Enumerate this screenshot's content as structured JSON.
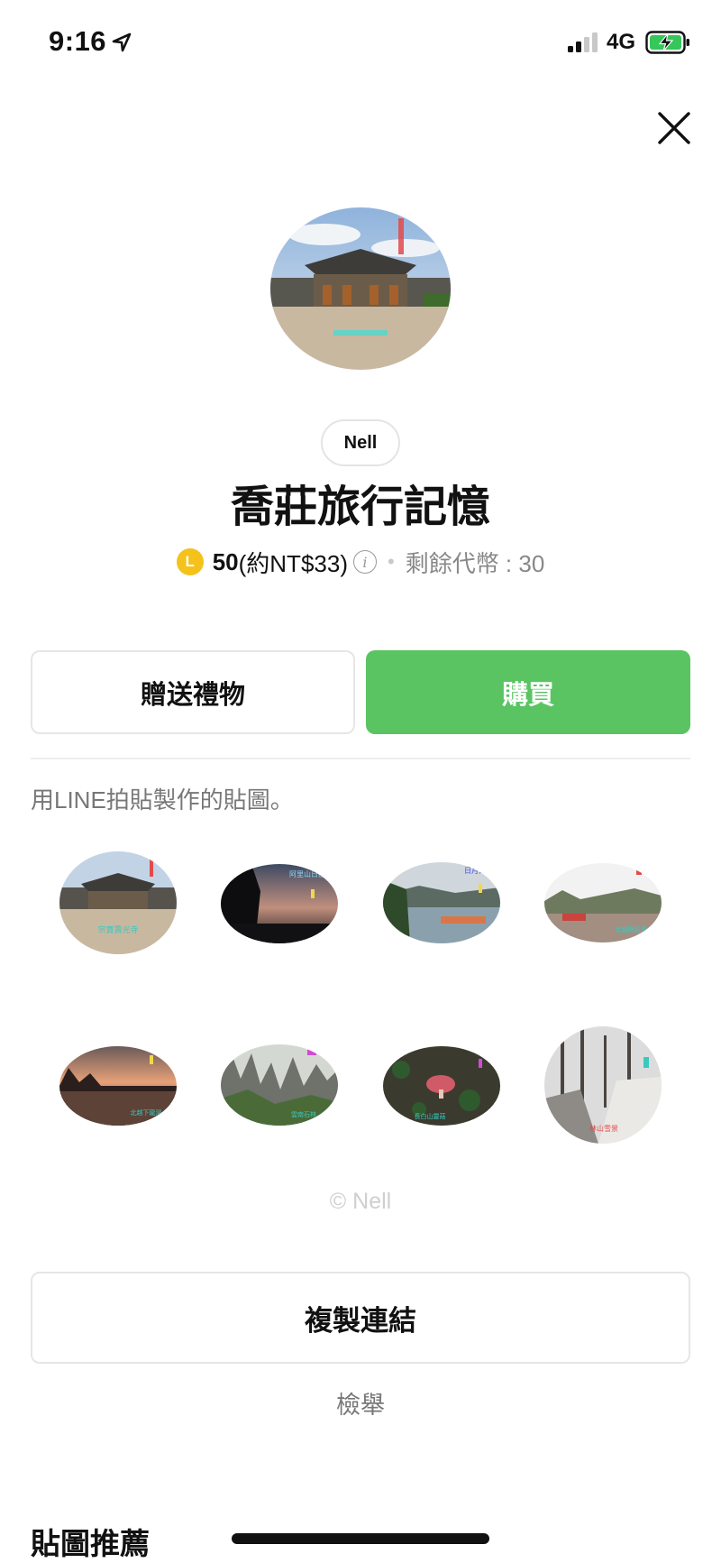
{
  "status_bar": {
    "time": "9:16",
    "network": "4G",
    "location_icon": "location-arrow-icon",
    "signal_icon": "signal-icon",
    "battery_icon": "battery-charging-icon"
  },
  "header": {
    "close_icon": "close-icon"
  },
  "product": {
    "author": "Nell",
    "title": "喬莊旅行記憶",
    "coin_symbol": "L",
    "price_amount": "50",
    "price_local": "(約NT$33)",
    "info_symbol": "i",
    "separator": "•",
    "remaining": "剩餘代幣 : 30"
  },
  "actions": {
    "gift_label": "贈送禮物",
    "buy_label": "購買"
  },
  "description": "用LINE拍貼製作的貼圖。",
  "stickers": [
    {
      "name": "sticker-temple",
      "caption": "宗寶壽光寺"
    },
    {
      "name": "sticker-dusk",
      "caption": "阿里山日出"
    },
    {
      "name": "sticker-lake",
      "caption": "日月潭"
    },
    {
      "name": "sticker-river",
      "caption": "北越雨船溝"
    },
    {
      "name": "sticker-sunset",
      "caption": "北越下龍灣"
    },
    {
      "name": "sticker-stone-forest",
      "caption": "雲南石林"
    },
    {
      "name": "sticker-mushroom",
      "caption": "長白山靈菇"
    },
    {
      "name": "sticker-snow",
      "caption": "林山雪景"
    }
  ],
  "copyright": "© Nell",
  "copy_link_label": "複製連結",
  "report_label": "檢舉",
  "recommend_title": "貼圖推薦",
  "colors": {
    "buy": "#5ac463",
    "coin": "#f4c21b",
    "muted": "#777777"
  }
}
